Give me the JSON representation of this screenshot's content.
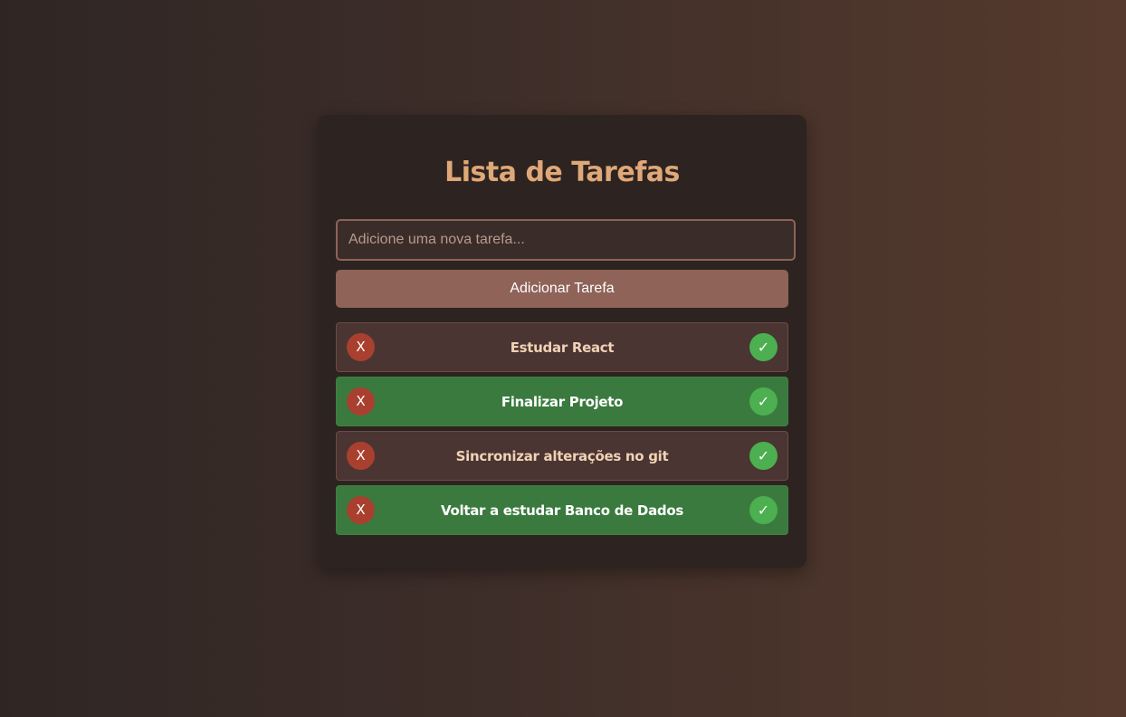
{
  "app": {
    "title": "Lista de Tarefas"
  },
  "input": {
    "value": "",
    "placeholder": "Adicione uma nova tarefa..."
  },
  "add_button": {
    "label": "Adicionar Tarefa"
  },
  "tasks": [
    {
      "text": "Estudar React",
      "completed": false,
      "delete_label": "X",
      "complete_label": "✓"
    },
    {
      "text": "Finalizar Projeto",
      "completed": true,
      "delete_label": "X",
      "complete_label": "✓"
    },
    {
      "text": "Sincronizar alterações no git",
      "completed": false,
      "delete_label": "X",
      "complete_label": "✓"
    },
    {
      "text": "Voltar a estudar Banco de Dados",
      "completed": true,
      "delete_label": "X",
      "complete_label": "✓"
    }
  ],
  "colors": {
    "accent": "#dfa878",
    "button": "#8f6357",
    "completed_task": "#3a7a3f",
    "pending_task": "#4a3533",
    "delete": "#a9402f",
    "complete": "#4caf50"
  }
}
